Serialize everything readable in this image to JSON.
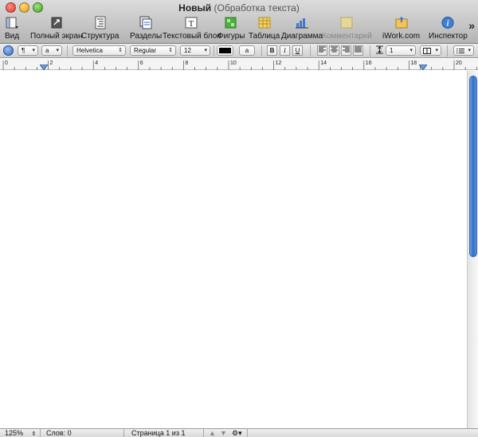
{
  "window": {
    "title": "Новый",
    "subtitle": "(Обработка текста)"
  },
  "toolbar": {
    "items": [
      {
        "label": "Вид",
        "icon": "view-icon"
      },
      {
        "label": "Полный экран",
        "icon": "fullscreen-icon"
      },
      {
        "label": "Структура",
        "icon": "outline-icon"
      },
      {
        "label": "Разделы",
        "icon": "sections-icon"
      },
      {
        "label": "Текстовый блок",
        "icon": "text-box-icon"
      },
      {
        "label": "Фигуры",
        "icon": "shapes-icon"
      },
      {
        "label": "Таблица",
        "icon": "table-icon"
      },
      {
        "label": "Диаграмма",
        "icon": "chart-icon"
      },
      {
        "label": "Комментарий",
        "icon": "comment-icon"
      },
      {
        "label": "iWork.com",
        "icon": "iwork-share-icon"
      },
      {
        "label": "Инспектор",
        "icon": "info-icon"
      }
    ],
    "overflow": "»"
  },
  "formatbar": {
    "paragraph_style": "¶",
    "char_style": "a",
    "font_family": "Helvetica",
    "font_style": "Regular",
    "font_size": "12",
    "text_color": "#000000",
    "highlight_label": "a",
    "bold": "B",
    "italic": "I",
    "underline": "U",
    "line_spacing": "1"
  },
  "ruler": {
    "labels": [
      "0",
      "2",
      "4",
      "6",
      "8",
      "10",
      "12",
      "14",
      "16",
      "18",
      "20"
    ]
  },
  "status": {
    "zoom": "125%",
    "words": "Слов: 0",
    "page": "Страница 1 из 1"
  },
  "colors": {
    "scroll_thumb": "#2f6dcc",
    "accent": "#3c67a8"
  }
}
